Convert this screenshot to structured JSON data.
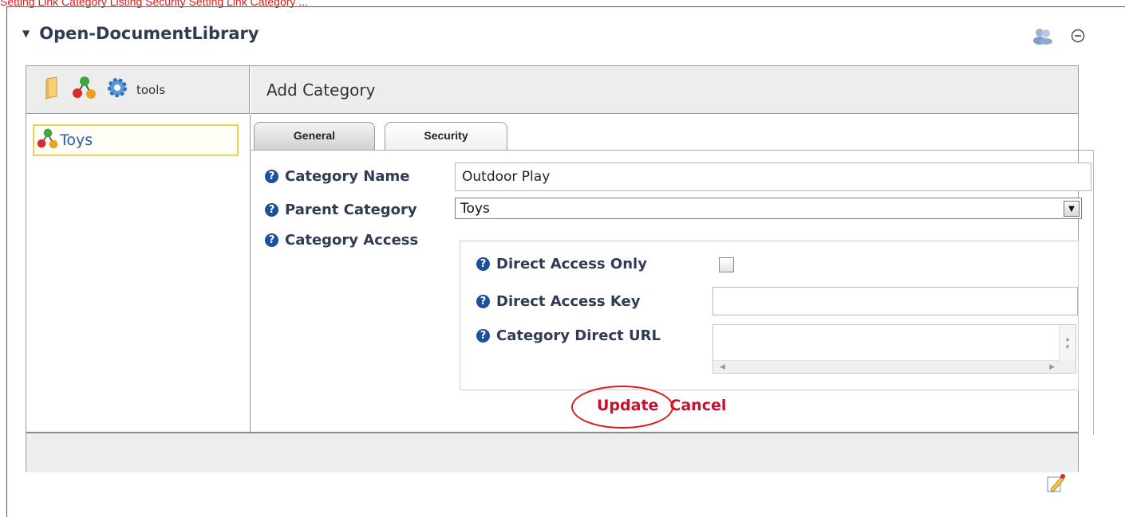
{
  "breadcrumb": "Setting Link Category Listing Security Setting Link Category ...",
  "module": {
    "title": "Open-DocumentLibrary"
  },
  "toolbar": {
    "tools_label": "tools"
  },
  "tree": {
    "items": [
      {
        "label": "Toys"
      }
    ]
  },
  "panel": {
    "title": "Add Category"
  },
  "tabs": [
    {
      "label": "General"
    },
    {
      "label": "Security"
    }
  ],
  "form": {
    "category_name": {
      "label": "Category Name",
      "value": "Outdoor Play"
    },
    "parent_category": {
      "label": "Parent Category",
      "value": "Toys"
    },
    "category_access": {
      "label": "Category Access"
    },
    "direct_access_only": {
      "label": "Direct Access Only",
      "checked": false
    },
    "direct_access_key": {
      "label": "Direct Access Key",
      "value": ""
    },
    "category_direct_url": {
      "label": "Category Direct URL",
      "value": ""
    }
  },
  "actions": {
    "update": "Update",
    "cancel": "Cancel"
  },
  "colors": {
    "accent_red": "#c8102e",
    "title_navy": "#303b55",
    "link_blue": "#2a5cb0"
  },
  "icons": [
    "folder-icon",
    "category-tree-icon",
    "gear-icon",
    "users-icon",
    "collapse-icon",
    "pencil-edit-icon",
    "help-icon"
  ]
}
